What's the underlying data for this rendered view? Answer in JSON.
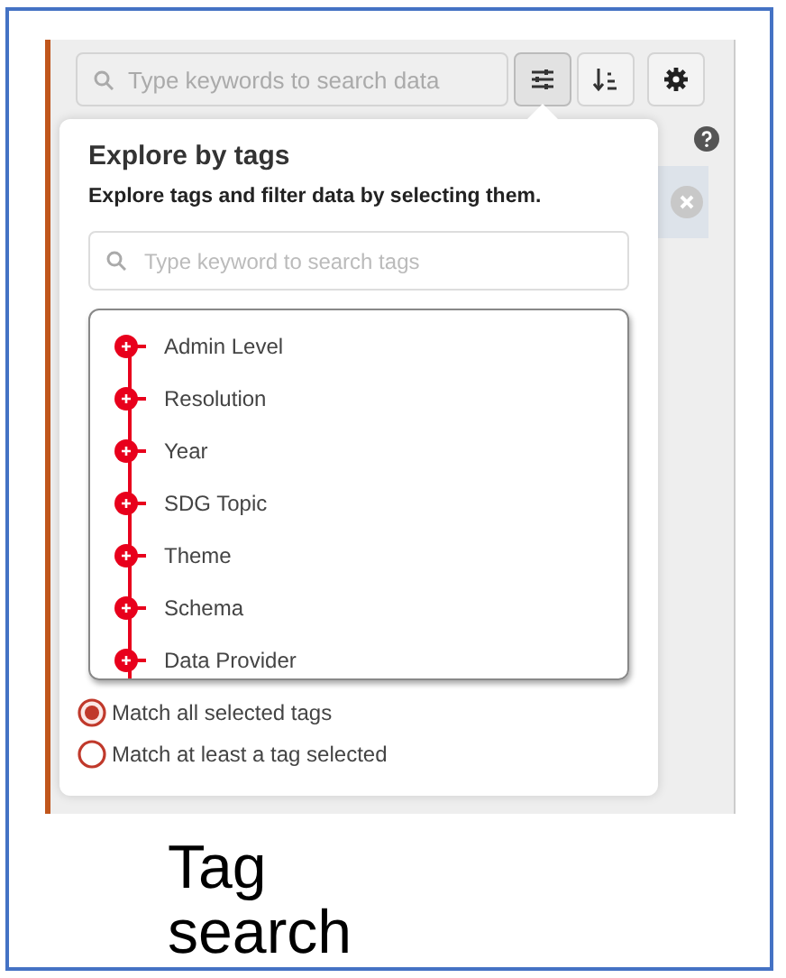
{
  "search": {
    "placeholder": "Type keywords to search data"
  },
  "toolbar": [
    {
      "kind": "filter",
      "selected": true
    },
    {
      "kind": "sort",
      "selected": false
    },
    {
      "kind": "settings",
      "selected": false
    }
  ],
  "popover": {
    "title": "Explore by tags",
    "subtitle": "Explore tags and filter data by selecting them.",
    "tag_search": {
      "placeholder": "Type keyword to search tags"
    },
    "tags": [
      {
        "label": "Admin Level",
        "expanded": false
      },
      {
        "label": "Resolution",
        "expanded": false
      },
      {
        "label": "Year",
        "expanded": false
      },
      {
        "label": "SDG Topic",
        "expanded": false
      },
      {
        "label": "Theme",
        "expanded": false
      },
      {
        "label": "Schema",
        "expanded": false
      },
      {
        "label": "Data Provider",
        "expanded": false
      }
    ],
    "match_options": [
      {
        "label": "Match all selected tags",
        "selected": true
      },
      {
        "label": "Match at least a tag selected",
        "selected": false
      }
    ]
  },
  "caption": "Tag search"
}
